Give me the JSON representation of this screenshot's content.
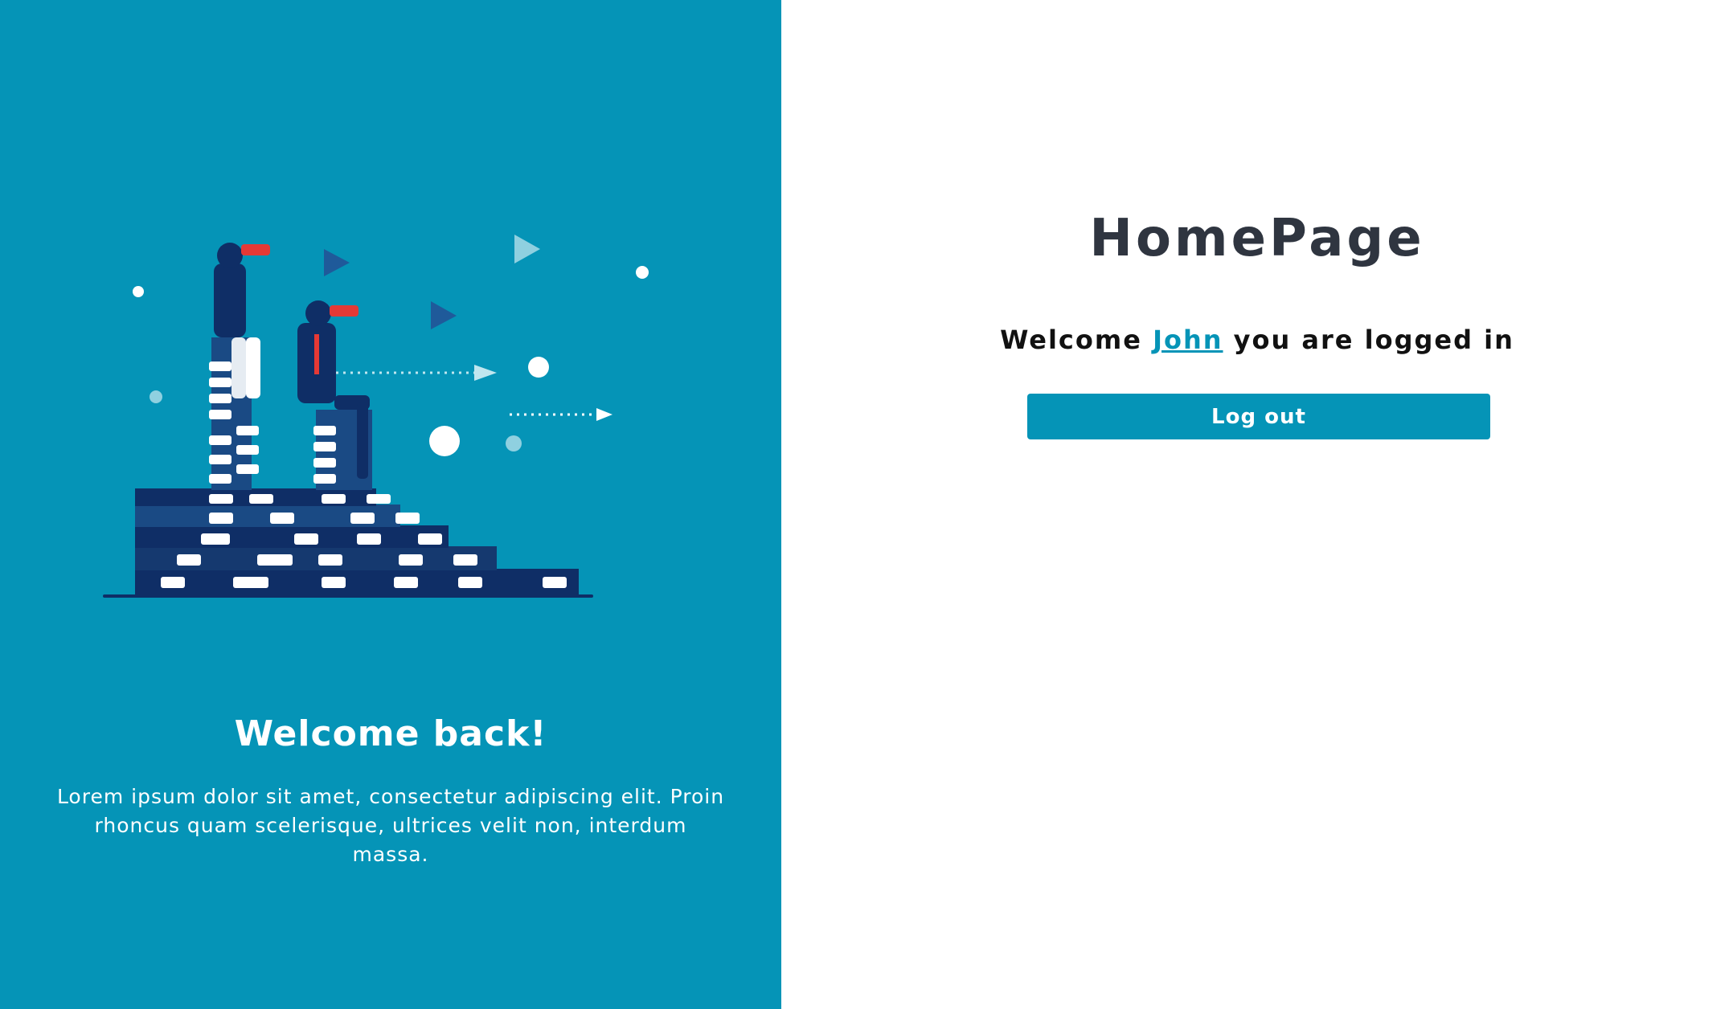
{
  "left_panel": {
    "heading": "Welcome back!",
    "description": "Lorem ipsum dolor sit amet, consectetur adipiscing elit. Proin rhoncus quam scelerisque, ultrices velit non, interdum massa.",
    "illustration": "business-people-with-binoculars-on-books-illustration",
    "background_color": "#0594b7"
  },
  "main": {
    "title": "HomePage",
    "welcome_prefix": "Welcome",
    "username": "John",
    "welcome_suffix": "you are logged in",
    "logout_label": "Log out",
    "accent_color": "#0594b7"
  }
}
